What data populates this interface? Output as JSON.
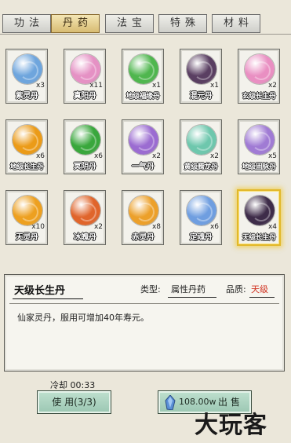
{
  "tabs": [
    {
      "label": "功法",
      "active": false
    },
    {
      "label": "丹药",
      "active": true
    },
    {
      "label": "法宝",
      "active": false
    },
    {
      "label": "特殊",
      "active": false
    },
    {
      "label": "材料",
      "active": false
    }
  ],
  "items": [
    {
      "name": "紫灵丹",
      "count": "x3",
      "color": "#6ea5dd"
    },
    {
      "name": "真阳丹",
      "count": "x11",
      "color": "#e591c4"
    },
    {
      "name": "地级福缘丹",
      "count": "x1",
      "color": "#4fb64e"
    },
    {
      "name": "混元丹",
      "count": "x1",
      "color": "#5a3f62"
    },
    {
      "name": "玄级长生丹",
      "count": "x2",
      "color": "#e98fc2"
    },
    {
      "name": "地级长生丹",
      "count": "x6",
      "color": "#eb9b18"
    },
    {
      "name": "冥阴丹",
      "count": "x6",
      "color": "#39a73c"
    },
    {
      "name": "一气丹",
      "count": "x2",
      "color": "#9b6cd1"
    },
    {
      "name": "黄级腾龙丹",
      "count": "x2",
      "color": "#6ec7ad"
    },
    {
      "name": "地级固脉丹",
      "count": "x5",
      "color": "#a07bd4"
    },
    {
      "name": "天灵丹",
      "count": "x10",
      "color": "#eda020"
    },
    {
      "name": "冰魄丹",
      "count": "x2",
      "color": "#e0652b"
    },
    {
      "name": "赤灵丹",
      "count": "x8",
      "color": "#eca02a"
    },
    {
      "name": "定魂丹",
      "count": "x6",
      "color": "#6f9ee0"
    },
    {
      "name": "天级长生丹",
      "count": "x4",
      "color": "#3e2c49",
      "selected": true
    }
  ],
  "detail": {
    "title": "天级长生丹",
    "type_label": "类型:",
    "type_value": "属性丹药",
    "quality_label": "品质:",
    "quality_value": "天级",
    "quality_color": "#d0301e",
    "description": "仙家灵丹，服用可增加40年寿元。"
  },
  "cooldown": "冷却 00:33",
  "use_button": "使 用(3/3)",
  "sell_button": {
    "price": "108.00w",
    "label": "出售"
  },
  "watermark": "大玩客"
}
